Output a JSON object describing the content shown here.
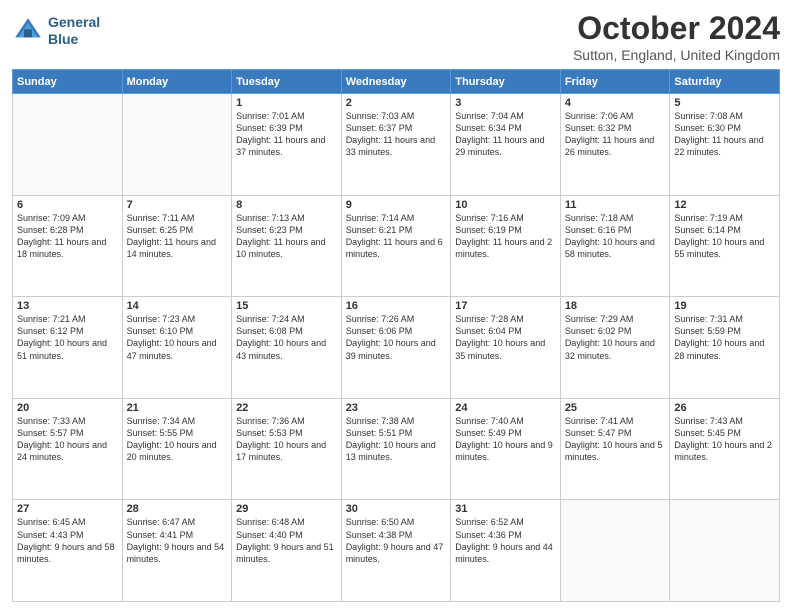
{
  "logo": {
    "line1": "General",
    "line2": "Blue"
  },
  "header": {
    "title": "October 2024",
    "location": "Sutton, England, United Kingdom"
  },
  "days_of_week": [
    "Sunday",
    "Monday",
    "Tuesday",
    "Wednesday",
    "Thursday",
    "Friday",
    "Saturday"
  ],
  "weeks": [
    [
      {
        "day": "",
        "sunrise": "",
        "sunset": "",
        "daylight": ""
      },
      {
        "day": "",
        "sunrise": "",
        "sunset": "",
        "daylight": ""
      },
      {
        "day": "1",
        "sunrise": "Sunrise: 7:01 AM",
        "sunset": "Sunset: 6:39 PM",
        "daylight": "Daylight: 11 hours and 37 minutes."
      },
      {
        "day": "2",
        "sunrise": "Sunrise: 7:03 AM",
        "sunset": "Sunset: 6:37 PM",
        "daylight": "Daylight: 11 hours and 33 minutes."
      },
      {
        "day": "3",
        "sunrise": "Sunrise: 7:04 AM",
        "sunset": "Sunset: 6:34 PM",
        "daylight": "Daylight: 11 hours and 29 minutes."
      },
      {
        "day": "4",
        "sunrise": "Sunrise: 7:06 AM",
        "sunset": "Sunset: 6:32 PM",
        "daylight": "Daylight: 11 hours and 26 minutes."
      },
      {
        "day": "5",
        "sunrise": "Sunrise: 7:08 AM",
        "sunset": "Sunset: 6:30 PM",
        "daylight": "Daylight: 11 hours and 22 minutes."
      }
    ],
    [
      {
        "day": "6",
        "sunrise": "Sunrise: 7:09 AM",
        "sunset": "Sunset: 6:28 PM",
        "daylight": "Daylight: 11 hours and 18 minutes."
      },
      {
        "day": "7",
        "sunrise": "Sunrise: 7:11 AM",
        "sunset": "Sunset: 6:25 PM",
        "daylight": "Daylight: 11 hours and 14 minutes."
      },
      {
        "day": "8",
        "sunrise": "Sunrise: 7:13 AM",
        "sunset": "Sunset: 6:23 PM",
        "daylight": "Daylight: 11 hours and 10 minutes."
      },
      {
        "day": "9",
        "sunrise": "Sunrise: 7:14 AM",
        "sunset": "Sunset: 6:21 PM",
        "daylight": "Daylight: 11 hours and 6 minutes."
      },
      {
        "day": "10",
        "sunrise": "Sunrise: 7:16 AM",
        "sunset": "Sunset: 6:19 PM",
        "daylight": "Daylight: 11 hours and 2 minutes."
      },
      {
        "day": "11",
        "sunrise": "Sunrise: 7:18 AM",
        "sunset": "Sunset: 6:16 PM",
        "daylight": "Daylight: 10 hours and 58 minutes."
      },
      {
        "day": "12",
        "sunrise": "Sunrise: 7:19 AM",
        "sunset": "Sunset: 6:14 PM",
        "daylight": "Daylight: 10 hours and 55 minutes."
      }
    ],
    [
      {
        "day": "13",
        "sunrise": "Sunrise: 7:21 AM",
        "sunset": "Sunset: 6:12 PM",
        "daylight": "Daylight: 10 hours and 51 minutes."
      },
      {
        "day": "14",
        "sunrise": "Sunrise: 7:23 AM",
        "sunset": "Sunset: 6:10 PM",
        "daylight": "Daylight: 10 hours and 47 minutes."
      },
      {
        "day": "15",
        "sunrise": "Sunrise: 7:24 AM",
        "sunset": "Sunset: 6:08 PM",
        "daylight": "Daylight: 10 hours and 43 minutes."
      },
      {
        "day": "16",
        "sunrise": "Sunrise: 7:26 AM",
        "sunset": "Sunset: 6:06 PM",
        "daylight": "Daylight: 10 hours and 39 minutes."
      },
      {
        "day": "17",
        "sunrise": "Sunrise: 7:28 AM",
        "sunset": "Sunset: 6:04 PM",
        "daylight": "Daylight: 10 hours and 35 minutes."
      },
      {
        "day": "18",
        "sunrise": "Sunrise: 7:29 AM",
        "sunset": "Sunset: 6:02 PM",
        "daylight": "Daylight: 10 hours and 32 minutes."
      },
      {
        "day": "19",
        "sunrise": "Sunrise: 7:31 AM",
        "sunset": "Sunset: 5:59 PM",
        "daylight": "Daylight: 10 hours and 28 minutes."
      }
    ],
    [
      {
        "day": "20",
        "sunrise": "Sunrise: 7:33 AM",
        "sunset": "Sunset: 5:57 PM",
        "daylight": "Daylight: 10 hours and 24 minutes."
      },
      {
        "day": "21",
        "sunrise": "Sunrise: 7:34 AM",
        "sunset": "Sunset: 5:55 PM",
        "daylight": "Daylight: 10 hours and 20 minutes."
      },
      {
        "day": "22",
        "sunrise": "Sunrise: 7:36 AM",
        "sunset": "Sunset: 5:53 PM",
        "daylight": "Daylight: 10 hours and 17 minutes."
      },
      {
        "day": "23",
        "sunrise": "Sunrise: 7:38 AM",
        "sunset": "Sunset: 5:51 PM",
        "daylight": "Daylight: 10 hours and 13 minutes."
      },
      {
        "day": "24",
        "sunrise": "Sunrise: 7:40 AM",
        "sunset": "Sunset: 5:49 PM",
        "daylight": "Daylight: 10 hours and 9 minutes."
      },
      {
        "day": "25",
        "sunrise": "Sunrise: 7:41 AM",
        "sunset": "Sunset: 5:47 PM",
        "daylight": "Daylight: 10 hours and 5 minutes."
      },
      {
        "day": "26",
        "sunrise": "Sunrise: 7:43 AM",
        "sunset": "Sunset: 5:45 PM",
        "daylight": "Daylight: 10 hours and 2 minutes."
      }
    ],
    [
      {
        "day": "27",
        "sunrise": "Sunrise: 6:45 AM",
        "sunset": "Sunset: 4:43 PM",
        "daylight": "Daylight: 9 hours and 58 minutes."
      },
      {
        "day": "28",
        "sunrise": "Sunrise: 6:47 AM",
        "sunset": "Sunset: 4:41 PM",
        "daylight": "Daylight: 9 hours and 54 minutes."
      },
      {
        "day": "29",
        "sunrise": "Sunrise: 6:48 AM",
        "sunset": "Sunset: 4:40 PM",
        "daylight": "Daylight: 9 hours and 51 minutes."
      },
      {
        "day": "30",
        "sunrise": "Sunrise: 6:50 AM",
        "sunset": "Sunset: 4:38 PM",
        "daylight": "Daylight: 9 hours and 47 minutes."
      },
      {
        "day": "31",
        "sunrise": "Sunrise: 6:52 AM",
        "sunset": "Sunset: 4:36 PM",
        "daylight": "Daylight: 9 hours and 44 minutes."
      },
      {
        "day": "",
        "sunrise": "",
        "sunset": "",
        "daylight": ""
      },
      {
        "day": "",
        "sunrise": "",
        "sunset": "",
        "daylight": ""
      }
    ]
  ]
}
